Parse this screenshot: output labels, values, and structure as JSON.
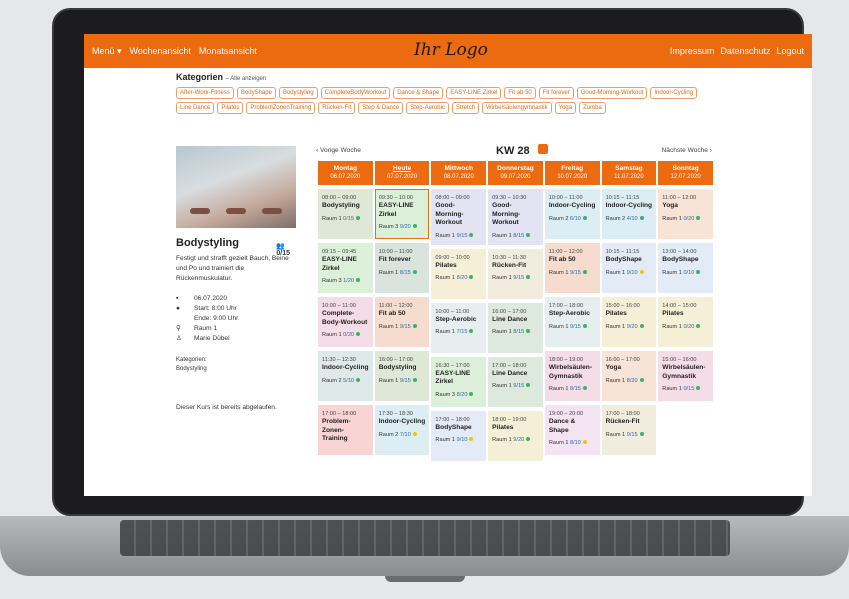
{
  "nav": {
    "menu": "Menü ▾",
    "week": "Wochenansicht",
    "month": "Monatsansicht",
    "logo": "Ihr Logo",
    "impressum": "Impressum",
    "datenschutz": "Datenschutz",
    "logout": "Logout"
  },
  "categories": {
    "title": "Kategorien",
    "show_all": "– Alle anzeigen",
    "items": [
      "After-Work-Fitness",
      "BodyShape",
      "Bodystyling",
      "CompleteBodyWorkout",
      "Dance & Shape",
      "EASY-LINE Zirkel",
      "Fit ab 50",
      "Fit forever",
      "Good-Morning-Workout",
      "Indoor-Cycling",
      "Line Dance",
      "Pilates",
      "ProblemZonenTraining",
      "Rücken-Fit",
      "Step & Dance",
      "Step-Aerobic",
      "Stretch",
      "Wirbelsäulengymnastik",
      "Yoga",
      "Zumba"
    ]
  },
  "detail": {
    "title": "Bodystyling",
    "count": "0/15",
    "desc": "Festigt und strafft gezielt Bauch, Beine und Po und trainiert die Rückenmuskulatur.",
    "date": "06.07.2020",
    "start": "Start: 8:00 Uhr",
    "end": "Ende: 9:00 Uhr",
    "room": "Raum 1",
    "trainer": "Marie Dübel",
    "cat_label": "Kategorien:",
    "cat_value": "Bodystyling",
    "expired": "Dieser Kurs ist bereits abgelaufen."
  },
  "week": {
    "prev": "‹ Vorige Woche",
    "next": "Nächste Woche ›",
    "kw": "KW 28"
  },
  "days": [
    {
      "name": "Montag",
      "date": "06.07.2020",
      "events": [
        {
          "time": "08:00 – 09:00",
          "name": "Bodystyling",
          "room": "Raum 1",
          "cap": "0/15",
          "bg": "#dfe8d7",
          "dot": "g"
        },
        {
          "time": "09:15 – 09:45",
          "name": "EASY-LINE Zirkel",
          "room": "Raum 3",
          "cap": "1/20",
          "bg": "#dcefd9",
          "dot": "g"
        },
        {
          "time": "10:00 – 11:00",
          "name": "Complete-Body-Workout",
          "room": "Raum 1",
          "cap": "0/20",
          "bg": "#f4dde6",
          "dot": "g"
        },
        {
          "time": "11:30 – 12:30",
          "name": "Indoor-Cycling",
          "room": "Raum 2",
          "cap": "5/10",
          "bg": "#dfe9ea",
          "dot": "g"
        },
        {
          "time": "17:00 – 18:00",
          "name": "Problem-Zonen-Training",
          "room": "",
          "cap": "",
          "bg": "#f8d4d4",
          "dot": ""
        }
      ]
    },
    {
      "name": "Heute",
      "date": "07.07.2020",
      "today": true,
      "events": [
        {
          "time": "09:30 – 10:00",
          "name": "EASY-LINE Zirkel",
          "room": "Raum 3",
          "cap": "9/20",
          "bg": "#dcefd9",
          "dot": "g",
          "sel": true
        },
        {
          "time": "10:00 – 11:00",
          "name": "Fit forever",
          "room": "Raum 1",
          "cap": "8/15",
          "bg": "#dbe3de",
          "dot": "g"
        },
        {
          "time": "11:00 – 12:00",
          "name": "Fit ab 50",
          "room": "Raum 1",
          "cap": "9/15",
          "bg": "#f6dccf",
          "dot": "g"
        },
        {
          "time": "16:00 – 17:00",
          "name": "Bodystyling",
          "room": "Raum 1",
          "cap": "9/15",
          "bg": "#dfe8d7",
          "dot": "g"
        },
        {
          "time": "17:30 – 18:30",
          "name": "Indoor-Cycling",
          "room": "Raum 2",
          "cap": "7/10",
          "bg": "#dceef3",
          "dot": "y"
        }
      ]
    },
    {
      "name": "Mittwoch",
      "date": "08.07.2020",
      "events": [
        {
          "time": "08:00 – 09:00",
          "name": "Good-Morning-Workout",
          "room": "Raum 1",
          "cap": "9/15",
          "bg": "#e4e3f3",
          "dot": "g"
        },
        {
          "time": "09:00 – 10:00",
          "name": "Pilates",
          "room": "Raum 1",
          "cap": "8/20",
          "bg": "#f6efd8",
          "dot": "g"
        },
        {
          "time": "10:00 – 11:00",
          "name": "Step-Aerobic",
          "room": "Raum 1",
          "cap": "7/15",
          "bg": "#e6eef0",
          "dot": "g"
        },
        {
          "time": "16:30 – 17:00",
          "name": "EASY-LINE Zirkel",
          "room": "Raum 3",
          "cap": "8/20",
          "bg": "#dcefd9",
          "dot": "g"
        },
        {
          "time": "17:00 – 18:00",
          "name": "BodyShape",
          "room": "Raum 1",
          "cap": "9/10",
          "bg": "#e3ebf6",
          "dot": "y"
        }
      ]
    },
    {
      "name": "Donnerstag",
      "date": "09.07.2020",
      "events": [
        {
          "time": "09:30 – 10:30",
          "name": "Good-Morning-Workout",
          "room": "Raum 1",
          "cap": "8/15",
          "bg": "#e4e3f3",
          "dot": "g"
        },
        {
          "time": "10:30 – 11:30",
          "name": "Rücken-Fit",
          "room": "Raum 1",
          "cap": "9/15",
          "bg": "#f2ecde",
          "dot": "g"
        },
        {
          "time": "16:00 – 17:00",
          "name": "Line Dance",
          "room": "Raum 1",
          "cap": "8/15",
          "bg": "#dde9dc",
          "dot": "g"
        },
        {
          "time": "17:00 – 18:00",
          "name": "Line Dance",
          "room": "Raum 1",
          "cap": "9/15",
          "bg": "#dde9dc",
          "dot": "g"
        },
        {
          "time": "18:00 – 19:00",
          "name": "Pilates",
          "room": "Raum 1",
          "cap": "9/20",
          "bg": "#f6efd8",
          "dot": "g"
        }
      ]
    },
    {
      "name": "Freitag",
      "date": "10.07.2020",
      "events": [
        {
          "time": "10:00 – 11:00",
          "name": "Indoor-Cycling",
          "room": "Raum 2",
          "cap": "6/10",
          "bg": "#dceef3",
          "dot": "g"
        },
        {
          "time": "11:00 – 12:00",
          "name": "Fit ab 50",
          "room": "Raum 1",
          "cap": "9/15",
          "bg": "#f6dccf",
          "dot": "g"
        },
        {
          "time": "17:00 – 18:00",
          "name": "Step-Aerobic",
          "room": "Raum 1",
          "cap": "9/15",
          "bg": "#e6eef0",
          "dot": "g"
        },
        {
          "time": "18:00 – 19:00",
          "name": "Wirbelsäulen-Gymnastik",
          "room": "Raum 1",
          "cap": "8/15",
          "bg": "#f4dde6",
          "dot": "g"
        },
        {
          "time": "19:00 – 20:00",
          "name": "Dance & Shape",
          "room": "Raum 1",
          "cap": "8/10",
          "bg": "#f3e3f3",
          "dot": "y"
        }
      ]
    },
    {
      "name": "Samstag",
      "date": "11.07.2020",
      "events": [
        {
          "time": "10:15 – 11:15",
          "name": "Indoor-Cycling",
          "room": "Raum 2",
          "cap": "4/10",
          "bg": "#dceef3",
          "dot": "g"
        },
        {
          "time": "10:15 – 11:15",
          "name": "BodyShape",
          "room": "Raum 1",
          "cap": "9/10",
          "bg": "#e3ebf6",
          "dot": "y"
        },
        {
          "time": "15:00 – 16:00",
          "name": "Pilates",
          "room": "Raum 1",
          "cap": "9/20",
          "bg": "#f6efd8",
          "dot": "g"
        },
        {
          "time": "16:00 – 17:00",
          "name": "Yoga",
          "room": "Raum 1",
          "cap": "8/20",
          "bg": "#f8e3d7",
          "dot": "g"
        },
        {
          "time": "17:00 – 18:00",
          "name": "Rücken-Fit",
          "room": "Raum 1",
          "cap": "9/15",
          "bg": "#f2ecde",
          "dot": "g"
        }
      ]
    },
    {
      "name": "Sonntag",
      "date": "12.07.2020",
      "events": [
        {
          "time": "11:00 – 12:00",
          "name": "Yoga",
          "room": "Raum 1",
          "cap": "0/20",
          "bg": "#f8e3d7",
          "dot": "g"
        },
        {
          "time": "13:00 – 14:00",
          "name": "BodyShape",
          "room": "Raum 1",
          "cap": "0/10",
          "bg": "#e3ebf6",
          "dot": "g"
        },
        {
          "time": "14:00 – 15:00",
          "name": "Pilates",
          "room": "Raum 1",
          "cap": "0/20",
          "bg": "#f6efd8",
          "dot": "g"
        },
        {
          "time": "15:00 – 16:00",
          "name": "Wirbelsäulen-Gymnastik",
          "room": "Raum 1",
          "cap": "0/15",
          "bg": "#f4dde6",
          "dot": "g"
        }
      ]
    }
  ]
}
